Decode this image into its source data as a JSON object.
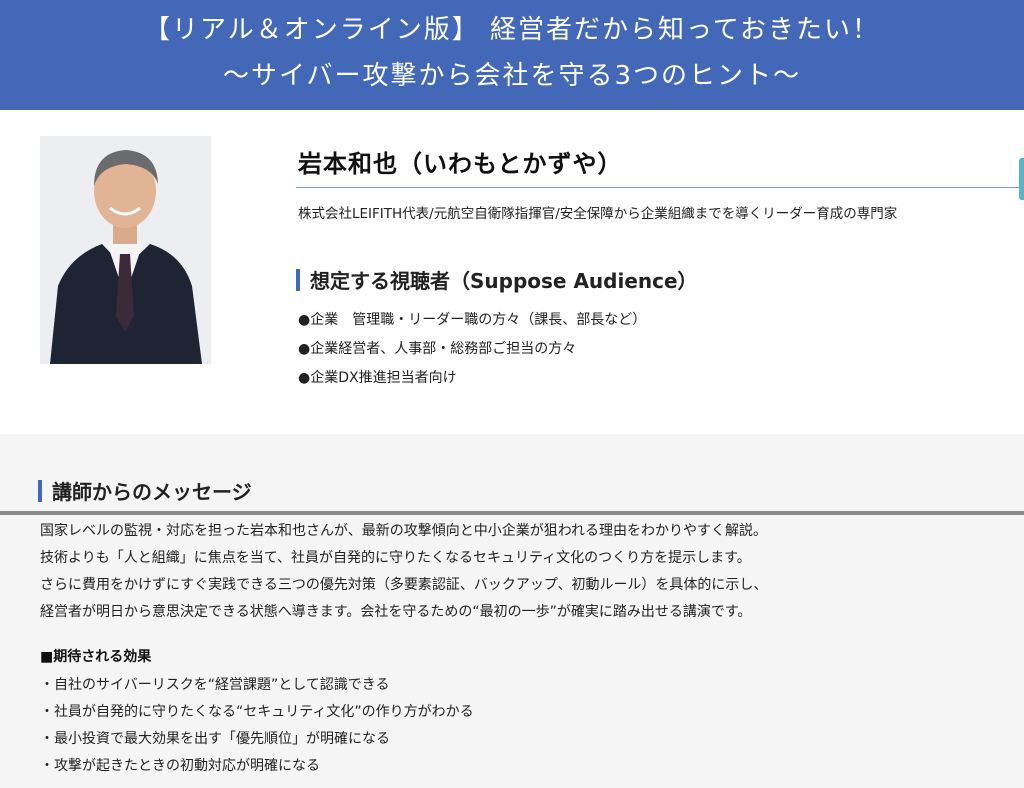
{
  "banner": {
    "line1": "【リアル＆オンライン版】 経営者だから知っておきたい！",
    "line2": "〜サイバー攻撃から会社を守る3つのヒント〜"
  },
  "speaker": {
    "name": "岩本和也（いわもとかずや）",
    "title": "株式会社LEIFITH代表/元航空自衛隊指揮官/安全保障から企業組織までを導くリーダー育成の専門家"
  },
  "audience": {
    "heading": "想定する視聴者（Suppose Audience）",
    "items": [
      "●企業　管理職・リーダー職の方々（課長、部長など）",
      "●企業経営者、人事部・総務部ご担当の方々",
      "●企業DX推進担当者向け"
    ]
  },
  "message": {
    "heading": "講師からのメッセージ",
    "paragraphs": [
      "国家レベルの監視・対応を担った岩本和也さんが、最新の攻撃傾向と中小企業が狙われる理由をわかりやすく解説。",
      "技術よりも「人と組織」に焦点を当て、社員が自発的に守りたくなるセキュリティ文化のつくり方を提示します。",
      "さらに費用をかけずにすぐ実践できる三つの優先対策（多要素認証、バックアップ、初動ルール）を具体的に示し、",
      "経営者が明日から意思決定できる状態へ導きます。会社を守るための“最初の一歩”が確実に踏み出せる講演です。"
    ],
    "effects_title": "■期待される効果",
    "effects": [
      "・自社のサイバーリスクを“経営課題”として認識できる",
      "・社員が自発的に守りたくなる“セキュリティ文化”の作り方がわかる",
      "・最小投資で最大効果を出す「優先順位」が明確になる",
      "・攻撃が起きたときの初動対応が明確になる"
    ]
  },
  "colors": {
    "banner": "#4468b8",
    "accent_bar": "#4468b8",
    "rule": "#7f9bc9",
    "edge_tab": "#5ab4c4",
    "message_bg": "#f5f5f5"
  }
}
